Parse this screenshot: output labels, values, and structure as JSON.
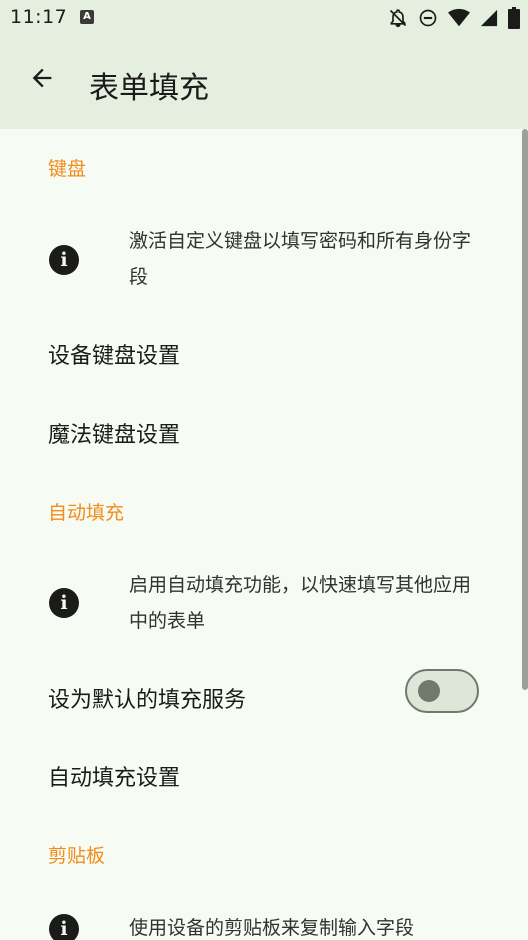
{
  "status_bar": {
    "time": "11:17",
    "app_icon_letter": "A",
    "icons": [
      "notifications-off-icon",
      "do-not-disturb-icon",
      "wifi-icon",
      "cell-signal-icon",
      "battery-icon"
    ]
  },
  "app_bar": {
    "back_icon": "arrow-back-icon",
    "title": "表单填充"
  },
  "sections": {
    "keyboard": {
      "header": "键盘",
      "info_text": "激活自定义键盘以填写密码和所有身份字段",
      "device_keyboard_settings": "设备键盘设置",
      "magic_keyboard_settings": "魔法键盘设置"
    },
    "autofill": {
      "header": "自动填充",
      "info_text": "启用自动填充功能，以快速填写其他应用中的表单",
      "default_service_label": "设为默认的填充服务",
      "default_service_enabled": false,
      "autofill_settings": "自动填充设置"
    },
    "clipboard": {
      "header": "剪贴板",
      "info_text": "使用设备的剪贴板来复制输入字段"
    }
  },
  "colors": {
    "accent": "#f28c1b",
    "app_bar_bg": "#e4efe0",
    "page_bg": "#f6fbf3"
  }
}
